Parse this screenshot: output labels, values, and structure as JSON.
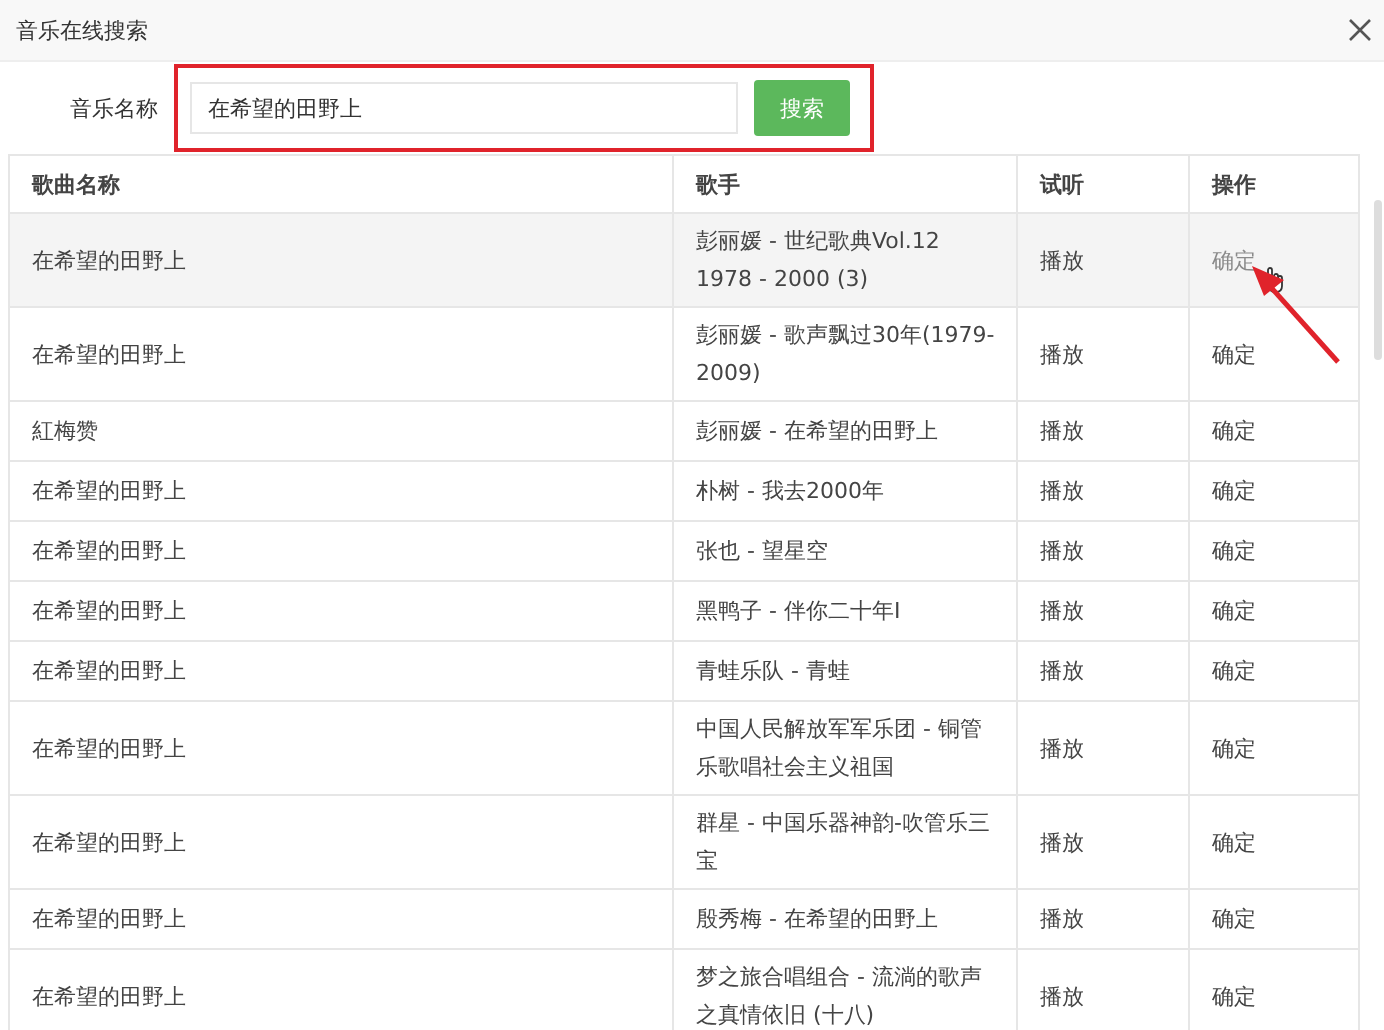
{
  "window": {
    "title": "音乐在线搜索"
  },
  "search": {
    "label": "音乐名称",
    "value": "在希望的田野上",
    "button": "搜索",
    "highlighted": true
  },
  "table": {
    "columns": [
      "歌曲名称",
      "歌手",
      "试听",
      "操作"
    ],
    "rows": [
      {
        "title": "在希望的田野上",
        "artist": "彭丽媛 - 世纪歌典Vol.12 1978 - 2000 (3)",
        "listen": "播放",
        "action": "确定",
        "hovered": true
      },
      {
        "title": "在希望的田野上",
        "artist": "彭丽媛 - 歌声飘过30年(1979-2009)",
        "listen": "播放",
        "action": "确定",
        "hovered": false
      },
      {
        "title": "紅梅赞",
        "artist": "彭丽媛 - 在希望的田野上",
        "listen": "播放",
        "action": "确定",
        "hovered": false
      },
      {
        "title": "在希望的田野上",
        "artist": "朴树 - 我去2000年",
        "listen": "播放",
        "action": "确定",
        "hovered": false
      },
      {
        "title": "在希望的田野上",
        "artist": "张也 - 望星空",
        "listen": "播放",
        "action": "确定",
        "hovered": false
      },
      {
        "title": "在希望的田野上",
        "artist": "黑鸭子 - 伴你二十年Ⅰ",
        "listen": "播放",
        "action": "确定",
        "hovered": false
      },
      {
        "title": "在希望的田野上",
        "artist": "青蛙乐队 - 青蛙",
        "listen": "播放",
        "action": "确定",
        "hovered": false
      },
      {
        "title": "在希望的田野上",
        "artist": "中国人民解放军军乐团 - 铜管乐歌唱社会主义祖国",
        "listen": "播放",
        "action": "确定",
        "hovered": false
      },
      {
        "title": "在希望的田野上",
        "artist": "群星 - 中国乐器神韵-吹管乐三宝",
        "listen": "播放",
        "action": "确定",
        "hovered": false
      },
      {
        "title": "在希望的田野上",
        "artist": "殷秀梅 - 在希望的田野上",
        "listen": "播放",
        "action": "确定",
        "hovered": false
      },
      {
        "title": "在希望的田野上",
        "artist": "梦之旅合唱组合 - 流淌的歌声之真情依旧 (十八)",
        "listen": "播放",
        "action": "确定",
        "hovered": false
      }
    ]
  }
}
